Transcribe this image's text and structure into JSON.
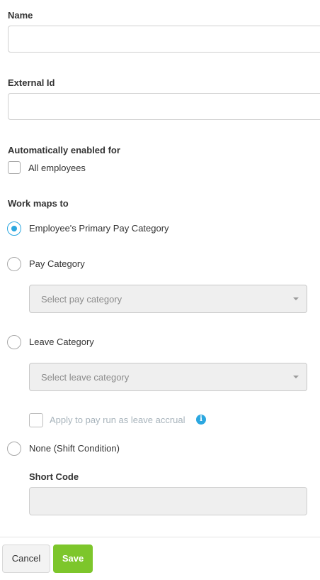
{
  "form": {
    "name_label": "Name",
    "name_value": "",
    "external_id_label": "External Id",
    "external_id_value": "",
    "auto_enabled_label": "Automatically enabled for",
    "all_employees_label": "All employees",
    "all_employees_checked": false,
    "work_maps_label": "Work maps to",
    "options": [
      {
        "label": "Employee's Primary Pay Category",
        "selected": true
      },
      {
        "label": "Pay Category",
        "selected": false
      },
      {
        "label": "Leave Category",
        "selected": false
      },
      {
        "label": "None (Shift Condition)",
        "selected": false
      }
    ],
    "pay_category_placeholder": "Select pay category",
    "leave_category_placeholder": "Select leave category",
    "leave_accrual_label": "Apply to pay run as leave accrual",
    "short_code_label": "Short Code",
    "short_code_value": ""
  },
  "actions": {
    "cancel_label": "Cancel",
    "save_label": "Save"
  },
  "colors": {
    "accent": "#2ba7e0",
    "save": "#7dc62b"
  },
  "icons": {
    "info": "info-icon",
    "caret": "chevron-down-icon"
  }
}
